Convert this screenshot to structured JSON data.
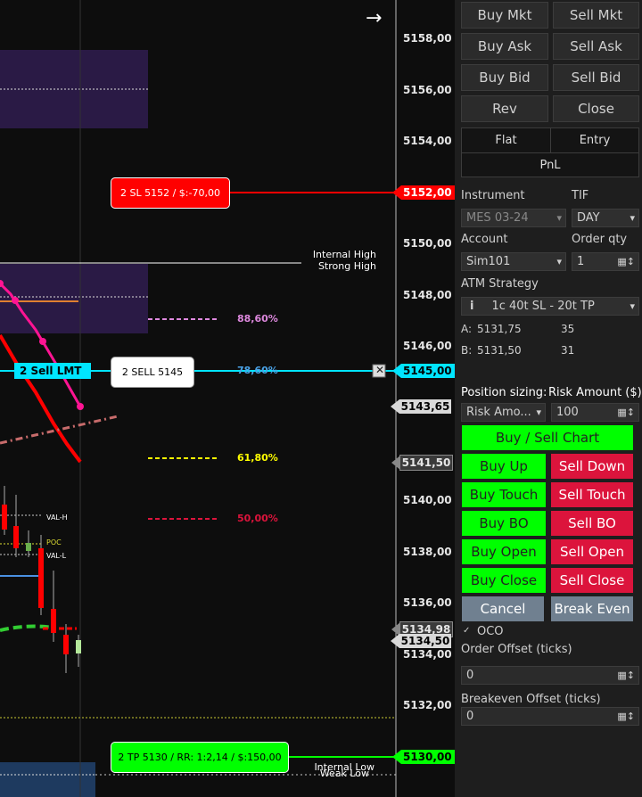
{
  "chart": {
    "price_labels": [
      "5158,00",
      "5156,00",
      "5154,00",
      "5152,00",
      "5150,00",
      "5148,00",
      "5146,00",
      "5145,00",
      "5143,65",
      "5141,50",
      "5140,00",
      "5138,00",
      "5136,00",
      "5134,98",
      "5134,50",
      "5134,00",
      "5132,00",
      "5130,00"
    ],
    "order_sl": "2 SL 5152 / $:-70,00",
    "order_tp": "2 TP 5130 / RR: 1:2,14 / $:150,00",
    "order_sell": "2 SELL 5145",
    "sell_lmt": "2  Sell LMT",
    "fib_88": "88,60%",
    "fib_78": "78,60%",
    "fib_61": "61,80%",
    "fib_50": "50,00%",
    "internal_high": "Internal High",
    "strong_high": "Strong High",
    "internal_low": "Internal Low",
    "weak_low": "Weak Low",
    "val_h": "VAL-H",
    "poc": "POC",
    "val_l": "VAL-L",
    "close_x": "✕",
    "arrow": "→"
  },
  "panel": {
    "buy_mkt": "Buy Mkt",
    "sell_mkt": "Sell Mkt",
    "buy_ask": "Buy Ask",
    "sell_ask": "Sell Ask",
    "buy_bid": "Buy Bid",
    "sell_bid": "Sell Bid",
    "rev": "Rev",
    "close": "Close",
    "flat": "Flat",
    "entry": "Entry",
    "pnl": "PnL",
    "instrument_label": "Instrument",
    "tif_label": "TIF",
    "instrument_value": "MES 03-24",
    "tif_value": "DAY",
    "account_label": "Account",
    "qty_label": "Order qty",
    "account_value": "Sim101",
    "qty_value": "1",
    "atm_label": "ATM Strategy",
    "atm_info": "i",
    "atm_value": "1c 40t SL - 20t TP",
    "a_label": "A:",
    "a_price": "5131,75",
    "a_size": "35",
    "b_label": "B:",
    "b_price": "5131,50",
    "b_size": "31",
    "position_sizing_label": "Position sizing:",
    "risk_amount_label": "Risk Amount ($)",
    "position_sizing_value": "Risk Amo...",
    "risk_amount_value": "100",
    "buy_sell_chart": "Buy / Sell Chart",
    "buy_up": "Buy Up",
    "sell_down": "Sell Down",
    "buy_touch": "Buy Touch",
    "sell_touch": "Sell Touch",
    "buy_bo": "Buy BO",
    "sell_bo": "Sell BO",
    "buy_open": "Buy Open",
    "sell_open": "Sell Open",
    "buy_close": "Buy Close",
    "sell_close": "Sell Close",
    "cancel": "Cancel",
    "break_even": "Break Even",
    "oco_check": "✓",
    "oco_label": "OCO",
    "order_offset_label": "Order Offset (ticks)",
    "order_offset_value": "0",
    "breakeven_offset_label": "Breakeven Offset (ticks)",
    "breakeven_offset_value": "0"
  },
  "colors": {
    "green": "#00ff00",
    "red": "#dc143c",
    "cyan": "#00e5ff",
    "magenta": "#ff1493"
  }
}
